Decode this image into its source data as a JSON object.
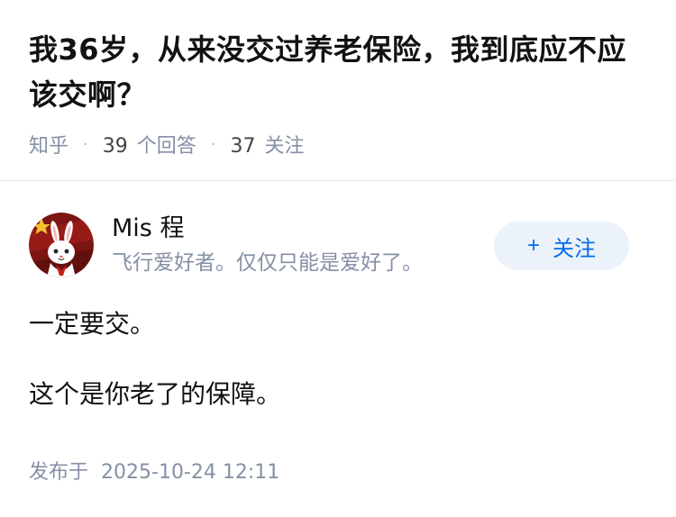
{
  "question": {
    "title": "我36岁，从来没交过养老保险，我到底应不应该交啊？",
    "source": "知乎",
    "answer_count": "39",
    "answer_label": "个回答",
    "follower_count": "37",
    "follower_label": "关注"
  },
  "author": {
    "name": "Mis 程",
    "bio": "飞行爱好者。仅仅只能是爱好了。",
    "follow_label": "关注",
    "follow_icon": "plus-icon",
    "avatar_icon": "rabbit-avatar"
  },
  "answer": {
    "paragraphs": [
      "一定要交。",
      "这个是你老了的保障。"
    ]
  },
  "footer": {
    "published_label": "发布于",
    "published_time": "2025-10-24 12:11"
  },
  "colors": {
    "primary_text": "#121212",
    "secondary_text": "#8590a6",
    "accent": "#056de8",
    "button_bg": "#ebf2fa"
  }
}
